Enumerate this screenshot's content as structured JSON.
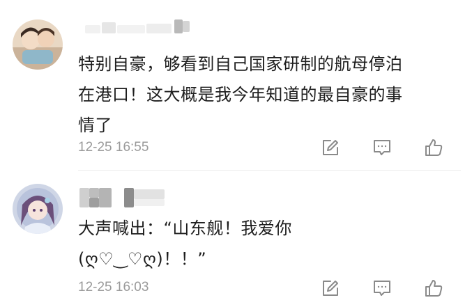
{
  "comments": [
    {
      "text_lines": [
        "特别自豪，够看到自己国家研制的航母停泊",
        "在港口！这大概是我今年知道的最自豪的事",
        "情了"
      ],
      "timestamp": "12-25 16:55",
      "actions": [
        "edit-icon",
        "comment-icon",
        "like-icon"
      ]
    },
    {
      "text_lines": [
        "大声喊出：“山东舰！我爱你",
        "(ღ♡‿♡ღ)！！”"
      ],
      "timestamp": "12-25 16:03",
      "actions": [
        "edit-icon",
        "comment-icon",
        "like-icon"
      ]
    }
  ],
  "colors": {
    "text": "#1e1e1e",
    "timestamp": "#9a9a9a",
    "icon": "#8a8a8a",
    "divider": "#ececec"
  }
}
